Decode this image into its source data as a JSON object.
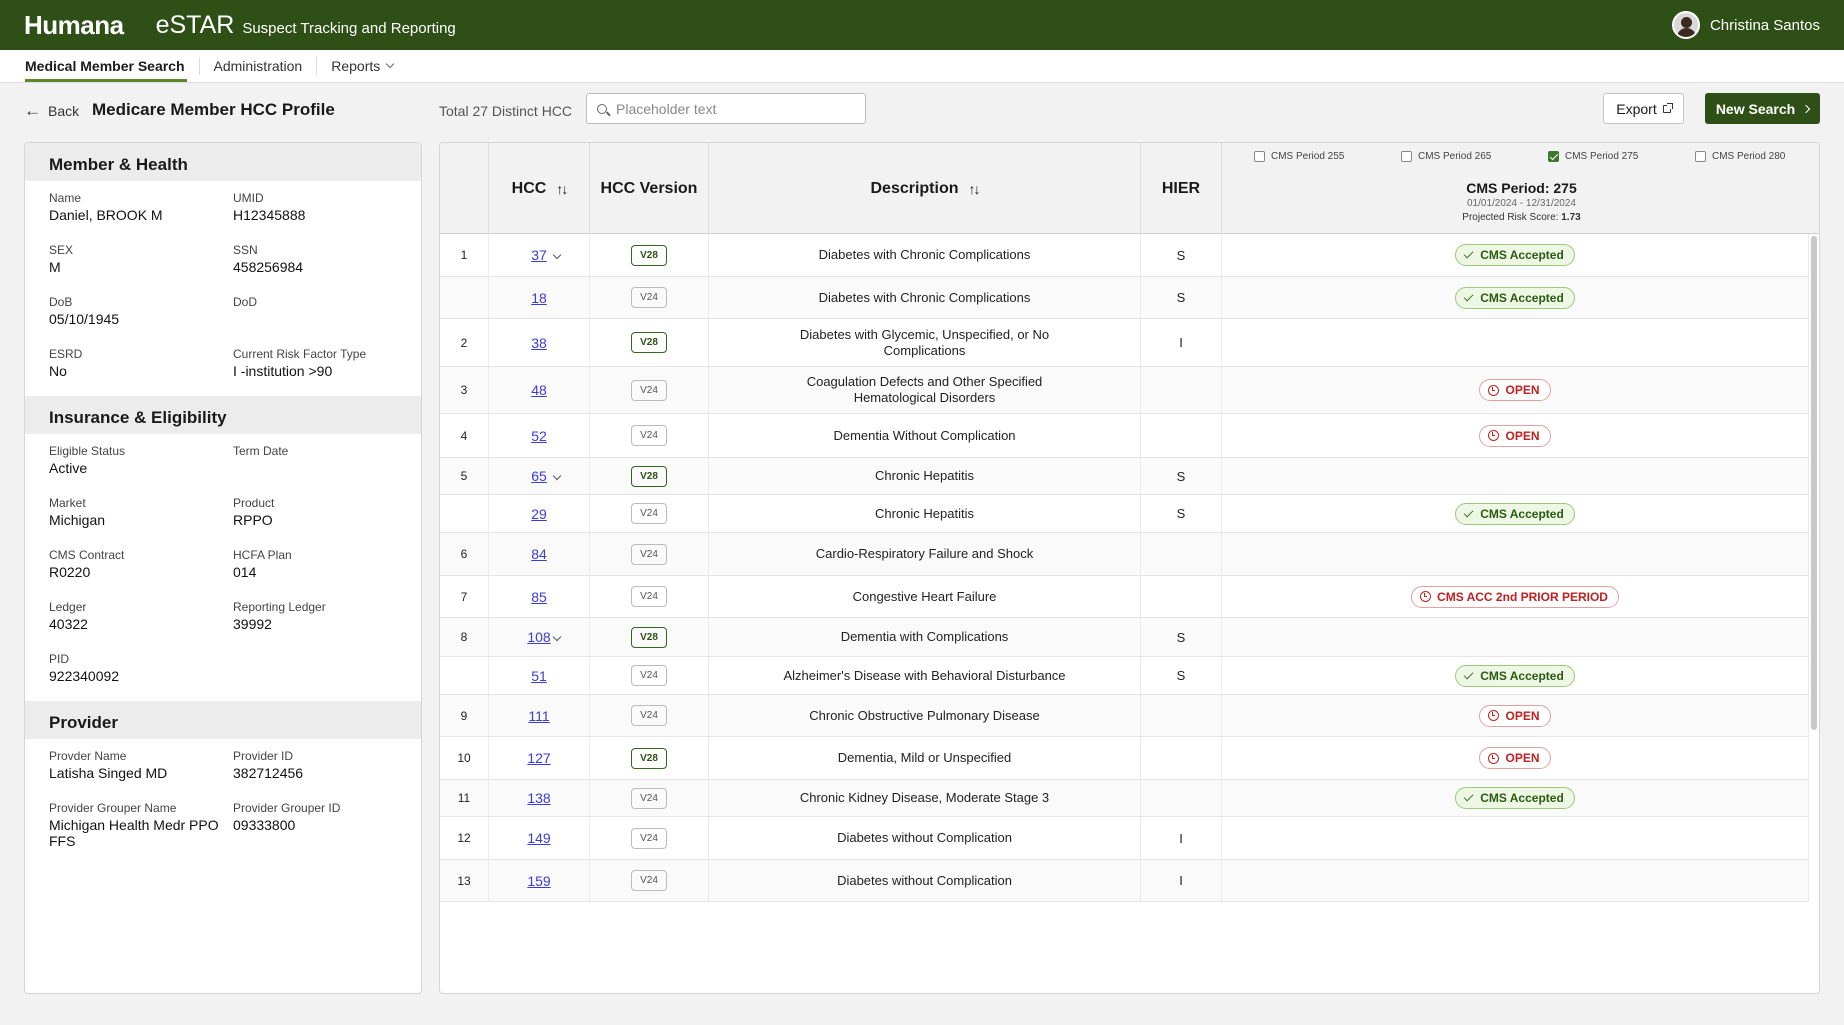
{
  "header": {
    "brand": "Humana",
    "app_name": "eSTAR",
    "app_subtitle": "Suspect Tracking and Reporting",
    "user_name": "Christina Santos"
  },
  "nav": {
    "items": [
      "Medical Member Search",
      "Administration",
      "Reports"
    ]
  },
  "toolbar": {
    "back_label": "Back",
    "page_title": "Medicare Member HCC Profile",
    "total_label": "Total 27 Distinct HCC",
    "search_placeholder": "Placeholder text",
    "export_label": "Export",
    "new_search_label": "New Search"
  },
  "member": {
    "section_title": "Member & Health",
    "fields": [
      {
        "label": "Name",
        "value": "Daniel, BROOK M"
      },
      {
        "label": "UMID",
        "value": "H12345888"
      },
      {
        "label": "SEX",
        "value": "M"
      },
      {
        "label": "SSN",
        "value": "458256984"
      },
      {
        "label": "DoB",
        "value": "05/10/1945"
      },
      {
        "label": "DoD",
        "value": ""
      },
      {
        "label": "ESRD",
        "value": "No"
      },
      {
        "label": "Current Risk Factor Type",
        "value": "I -institution >90"
      }
    ]
  },
  "insurance": {
    "section_title": "Insurance & Eligibility",
    "fields": [
      {
        "label": "Eligible Status",
        "value": "Active"
      },
      {
        "label": "Term Date",
        "value": ""
      },
      {
        "label": "Market",
        "value": "Michigan"
      },
      {
        "label": "Product",
        "value": "RPPO"
      },
      {
        "label": "CMS Contract",
        "value": "R0220"
      },
      {
        "label": "HCFA Plan",
        "value": "014"
      },
      {
        "label": "Ledger",
        "value": "40322"
      },
      {
        "label": "Reporting Ledger",
        "value": "39992"
      },
      {
        "label": "PID",
        "value": "922340092"
      }
    ]
  },
  "provider": {
    "section_title": "Provider",
    "fields": [
      {
        "label": "Provder Name",
        "value": "Latisha Singed MD"
      },
      {
        "label": "Provider ID",
        "value": "382712456"
      },
      {
        "label": "Provider Grouper Name",
        "value": "Michigan Health Medr PPO FFS"
      },
      {
        "label": "Provider Grouper ID",
        "value": "09333800"
      }
    ]
  },
  "table": {
    "columns": {
      "hcc": "HCC",
      "version": "HCC Version",
      "description": "Description",
      "hier": "HIER"
    },
    "periods": [
      {
        "label": "CMS Period 255",
        "checked": false
      },
      {
        "label": "CMS Period 265",
        "checked": false
      },
      {
        "label": "CMS Period 275",
        "checked": true
      },
      {
        "label": "CMS Period 280",
        "checked": false
      }
    ],
    "selected_period": {
      "title": "CMS Period: 275",
      "dates": "01/01/2024 - 12/31/2024",
      "risk_label": "Projected Risk Score:",
      "risk_value": "1.73"
    },
    "rows": [
      {
        "num": "1",
        "expand": true,
        "hcc": "37",
        "version": "V28",
        "description": "Diabetes with Chronic Complications",
        "hier": "S",
        "status": "CMS Accepted",
        "status_type": "acc"
      },
      {
        "num": "",
        "expand": false,
        "hcc": "18",
        "version": "V24",
        "description": "Diabetes with Chronic Complications",
        "hier": "S",
        "status": "CMS Accepted",
        "status_type": "acc"
      },
      {
        "num": "2",
        "expand": false,
        "hcc": "38",
        "version": "V28",
        "description": "Diabetes with Glycemic, Unspecified, or No Complications",
        "hier": "I",
        "status": "",
        "status_type": ""
      },
      {
        "num": "3",
        "expand": false,
        "hcc": "48",
        "version": "V24",
        "description": "Coagulation Defects and Other Specified Hematological Disorders",
        "hier": "",
        "status": "OPEN",
        "status_type": "open"
      },
      {
        "num": "4",
        "expand": false,
        "hcc": "52",
        "version": "V24",
        "description": "Dementia Without Complication",
        "hier": "",
        "status": "OPEN",
        "status_type": "open"
      },
      {
        "num": "5",
        "expand": true,
        "hcc": "65",
        "version": "V28",
        "description": "Chronic Hepatitis",
        "hier": "S",
        "status": "",
        "status_type": ""
      },
      {
        "num": "",
        "expand": false,
        "hcc": "29",
        "version": "V24",
        "description": "Chronic Hepatitis",
        "hier": "S",
        "status": "CMS Accepted",
        "status_type": "acc"
      },
      {
        "num": "6",
        "expand": false,
        "hcc": "84",
        "version": "V24",
        "description": "Cardio-Respiratory Failure and Shock",
        "hier": "",
        "status": "",
        "status_type": ""
      },
      {
        "num": "7",
        "expand": false,
        "hcc": "85",
        "version": "V24",
        "description": "Congestive Heart Failure",
        "hier": "",
        "status": "CMS ACC 2nd PRIOR PERIOD",
        "status_type": "open"
      },
      {
        "num": "8",
        "expand": true,
        "hcc": "108",
        "version": "V28",
        "description": "Dementia with Complications",
        "hier": "S",
        "status": "",
        "status_type": ""
      },
      {
        "num": "",
        "expand": false,
        "hcc": "51",
        "version": "V24",
        "description": "Alzheimer's Disease with Behavioral Disturbance",
        "hier": "S",
        "status": "CMS Accepted",
        "status_type": "acc"
      },
      {
        "num": "9",
        "expand": false,
        "hcc": "111",
        "version": "V24",
        "description": "Chronic Obstructive Pulmonary Disease",
        "hier": "",
        "status": "OPEN",
        "status_type": "open"
      },
      {
        "num": "10",
        "expand": false,
        "hcc": "127",
        "version": "V28",
        "description": "Dementia, Mild or Unspecified",
        "hier": "",
        "status": "OPEN",
        "status_type": "open"
      },
      {
        "num": "11",
        "expand": false,
        "hcc": "138",
        "version": "V24",
        "description": "Chronic Kidney Disease, Moderate Stage 3",
        "hier": "",
        "status": "CMS Accepted",
        "status_type": "acc"
      },
      {
        "num": "12",
        "expand": false,
        "hcc": "149",
        "version": "V24",
        "description": "Diabetes without Complication",
        "hier": "I",
        "status": "",
        "status_type": ""
      },
      {
        "num": "13",
        "expand": false,
        "hcc": "159",
        "version": "V24",
        "description": "Diabetes without Complication",
        "hier": "I",
        "status": "",
        "status_type": ""
      }
    ]
  }
}
